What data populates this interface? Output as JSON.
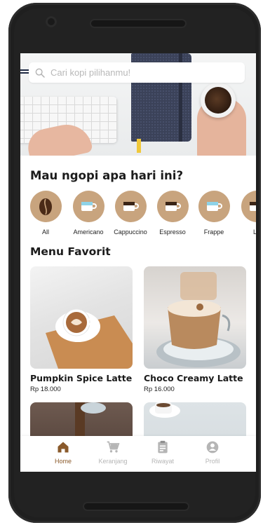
{
  "search": {
    "placeholder": "Cari kopi pilihanmu!"
  },
  "section_category": {
    "title": "Mau ngopi apa hari ini?"
  },
  "categories": [
    {
      "label": "All",
      "icon": "coffee-bean-icon"
    },
    {
      "label": "Americano",
      "icon": "americano-cup-icon"
    },
    {
      "label": "Cappuccino",
      "icon": "cappuccino-cup-icon"
    },
    {
      "label": "Espresso",
      "icon": "espresso-cup-icon"
    },
    {
      "label": "Frappe",
      "icon": "frappe-cup-icon"
    },
    {
      "label": "La",
      "icon": "latte-cup-icon"
    }
  ],
  "section_favorite": {
    "title": "Menu Favorit"
  },
  "menu": [
    {
      "name": "Pumpkin Spice Latte",
      "price": "Rp 18.000"
    },
    {
      "name": "Choco Creamy Latte",
      "price": "Rp 16.000"
    }
  ],
  "nav": [
    {
      "label": "Home",
      "icon": "home-icon",
      "active": true
    },
    {
      "label": "Keranjang",
      "icon": "cart-icon",
      "active": false
    },
    {
      "label": "Riwayat",
      "icon": "history-icon",
      "active": false
    },
    {
      "label": "Profil",
      "icon": "profile-icon",
      "active": false
    }
  ],
  "colors": {
    "accent": "#8a5a2b",
    "category_circle": "#c8a47e",
    "nav_inactive": "#b5b5b5"
  }
}
